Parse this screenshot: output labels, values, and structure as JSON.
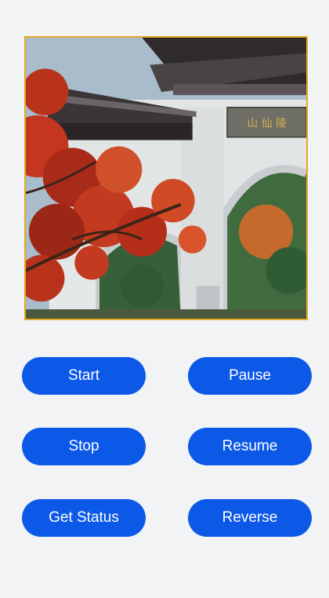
{
  "image": {
    "icon": "gate-photo",
    "colors": {
      "border": "#e7a823",
      "leaves": "#c0331c",
      "wall": "#dfe3e4",
      "roof": "#3a3536"
    },
    "sign_text": "山 仙 陵"
  },
  "buttons": {
    "start": "Start",
    "pause": "Pause",
    "stop": "Stop",
    "resume": "Resume",
    "get_status": "Get Status",
    "reverse": "Reverse"
  },
  "colors": {
    "accent": "#0d59e7",
    "background": "#f1f3f5"
  }
}
